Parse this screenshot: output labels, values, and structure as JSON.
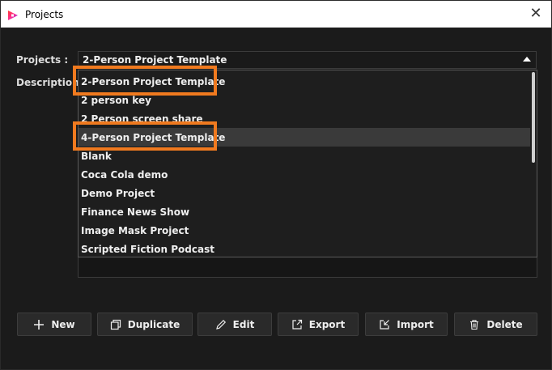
{
  "window": {
    "title": "Projects",
    "close_glyph": "✕"
  },
  "form": {
    "projects_label": "Projects :",
    "description_label": "Description",
    "selected_project": "2-Person Project Template"
  },
  "dropdown": {
    "items": [
      "2-Person Project Template",
      "2 person key",
      "2 Person screen share",
      "4-Person Project Template",
      "Blank",
      "Coca Cola demo",
      "Demo Project",
      "Finance News Show",
      "Image Mask Project",
      "Scripted Fiction Podcast"
    ],
    "selected_index": 3
  },
  "buttons": {
    "new": "New",
    "duplicate": "Duplicate",
    "edit": "Edit",
    "export": "Export",
    "import": "Import",
    "delete": "Delete"
  },
  "colors": {
    "highlight": "#f07a1f",
    "background": "#1b1b1b",
    "titlebar": "#ffffff"
  },
  "icons": [
    "app-logo-icon",
    "close-icon",
    "chevron-up-icon",
    "plus-icon",
    "duplicate-icon",
    "pencil-icon",
    "export-icon",
    "import-icon",
    "trash-icon"
  ]
}
